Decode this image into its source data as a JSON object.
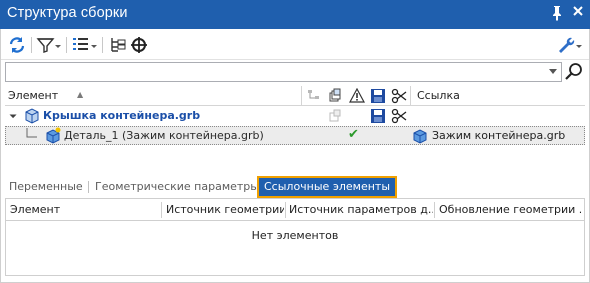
{
  "window": {
    "title": "Структура сборки",
    "pin_icon": "pin-icon",
    "close_icon": "close-icon",
    "titlebar_color": "#1f5fae"
  },
  "toolbar": {
    "icons": [
      "refresh-icon",
      "filter-icon",
      "columns-settings-icon",
      "tree-structure-icon",
      "crosshair-icon",
      "wrench-settings-icon"
    ]
  },
  "search": {
    "value": "",
    "placeholder": "",
    "search_icon": "magnifier-icon"
  },
  "tree": {
    "header": {
      "element": "Элемент",
      "link": "Ссылка",
      "icons": [
        "hierarchy-icon",
        "part-stack-icon",
        "warning-icon",
        "save-icon",
        "scissors-icon"
      ]
    },
    "rows": [
      {
        "label": "Крышка контейнера.grb",
        "icon": "assembly-icon"
      },
      {
        "label": "Деталь_1 (Зажим контейнера.grb)",
        "icon": "part-icon",
        "status": "✔",
        "ref_label": "Зажим контейнера.grb",
        "ref_icon": "part-file-icon"
      }
    ]
  },
  "tabs": [
    {
      "label": "Переменные"
    },
    {
      "label": "Геометрические параметры"
    },
    {
      "label": "Ссылочные элементы",
      "active": true
    }
  ],
  "grid": {
    "columns": [
      "Элемент",
      "Источник геометрии",
      "Источник параметров д...",
      "Обновление геометрии ..."
    ],
    "empty_text": "Нет элементов"
  },
  "colors": {
    "accent": "#1f5fae",
    "active_tab_border": "#f0a000",
    "check_green": "#2c9a2c"
  }
}
